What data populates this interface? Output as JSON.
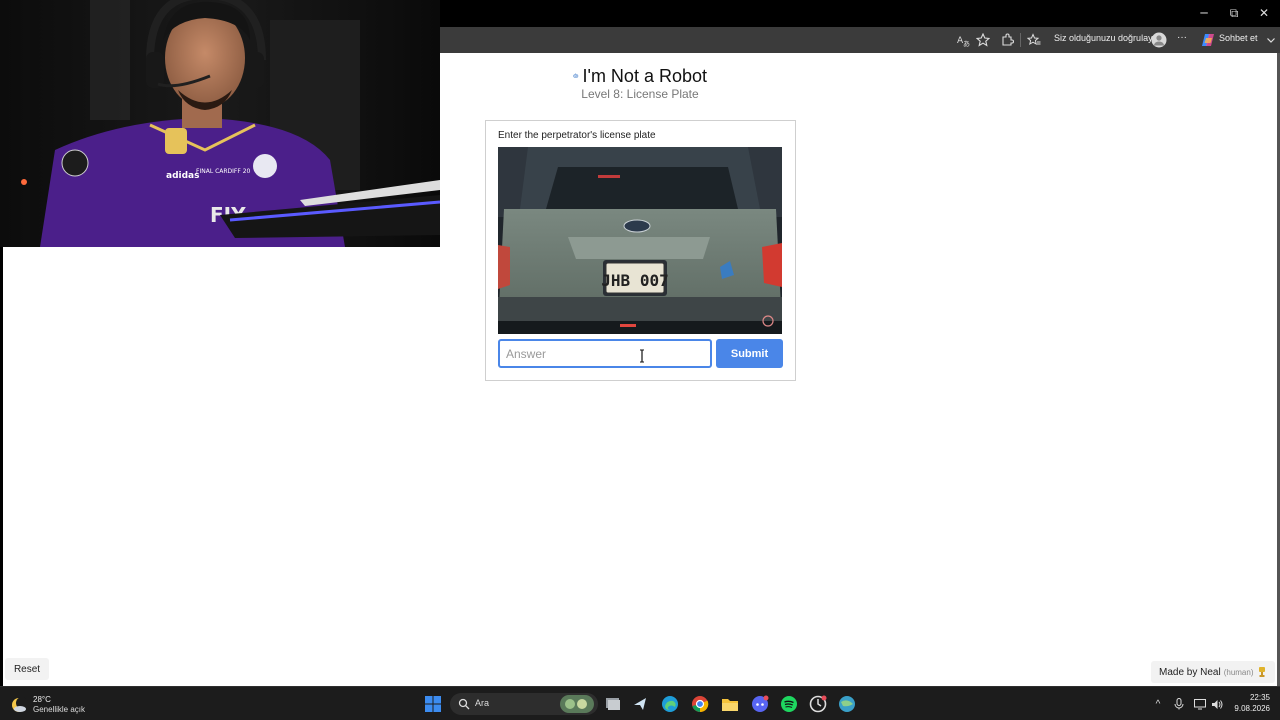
{
  "window": {
    "controls": {
      "minimize": "─",
      "restore": "⧉",
      "close": "✕"
    }
  },
  "browser": {
    "verify_prompt": "Siz olduğunuzu doğrulayın",
    "copilot_label": "Sohbet et",
    "more_glyph": "···",
    "icons": [
      "translate-icon",
      "star-icon",
      "extensions-icon",
      "favorites-icon",
      "profile-avatar",
      "more-icon",
      "copilot-icon",
      "chevron-down-icon"
    ]
  },
  "page": {
    "title": "I'm Not a Robot",
    "subtitle": "Level 8: License Plate",
    "captcha": {
      "prompt": "Enter the perpetrator's license plate",
      "plate_text": "JHB 007",
      "answer_placeholder": "Answer",
      "submit_label": "Submit"
    },
    "reset_label": "Reset",
    "credit": {
      "author": "Made by Neal",
      "tag": "(human)"
    }
  },
  "webcam": {
    "jersey_text": "FIY",
    "patch_text": "FINAL CARDIFF 20",
    "brand_text": "adidas"
  },
  "taskbar": {
    "weather": {
      "temp": "28°C",
      "condition": "Genellikle açık"
    },
    "search_placeholder": "Ara",
    "apps": [
      "windows-start-icon",
      "search-icon",
      "task-view-icon",
      "steam-icon",
      "edge-icon",
      "chrome-icon",
      "file-explorer-icon",
      "discord-icon",
      "spotify-icon",
      "app-icon",
      "network-app-icon"
    ],
    "tray": {
      "chevron": "^"
    },
    "clock": {
      "time": "22:35",
      "date": "9.08.2026"
    }
  },
  "colors": {
    "accent": "#4a86e8",
    "page_background": "#ffffff",
    "toolbar_background": "#3b3b3b",
    "taskbar_background": "#1c1c1c",
    "jersey": "#4b1f8a"
  }
}
